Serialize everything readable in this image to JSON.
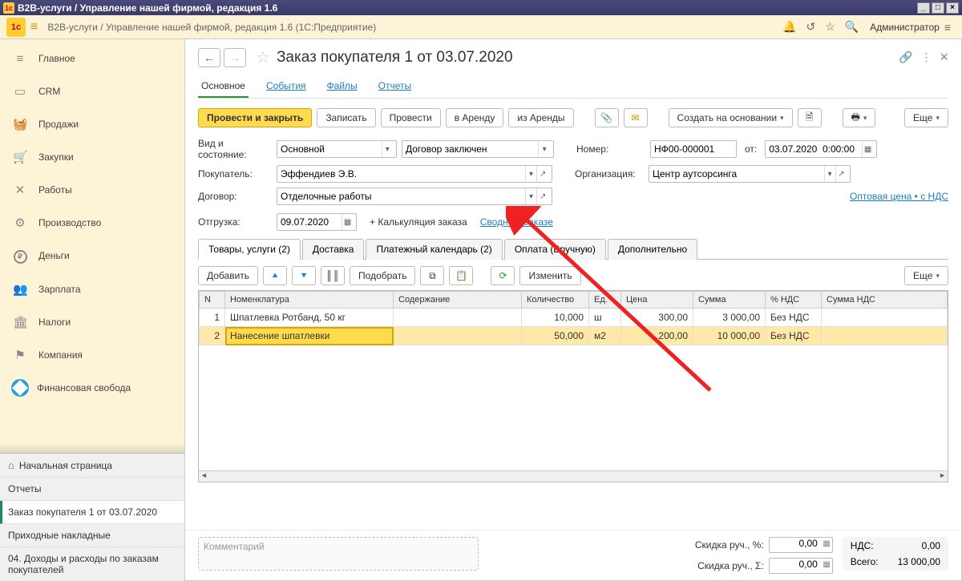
{
  "window": {
    "title": "B2B-услуги / Управление нашей фирмой, редакция 1.6"
  },
  "topbar": {
    "breadcrumb": "B2B-услуги / Управление нашей фирмой, редакция 1.6  (1С:Предприятие)",
    "admin": "Администратор"
  },
  "sidebar": {
    "nav": [
      {
        "label": "Главное",
        "icon": "≡"
      },
      {
        "label": "CRM",
        "icon": "▣"
      },
      {
        "label": "Продажи",
        "icon": "🛍"
      },
      {
        "label": "Закупки",
        "icon": "🛒"
      },
      {
        "label": "Работы",
        "icon": "✖"
      },
      {
        "label": "Производство",
        "icon": "🏭"
      },
      {
        "label": "Деньги",
        "icon": "₽"
      },
      {
        "label": "Зарплата",
        "icon": "👥"
      },
      {
        "label": "Налоги",
        "icon": "🏛"
      },
      {
        "label": "Компания",
        "icon": "⚑"
      }
    ],
    "fin": "Финансовая свобода",
    "open": [
      {
        "label": "Начальная страница",
        "home": true
      },
      {
        "label": "Отчеты"
      },
      {
        "label": "Заказ покупателя 1 от 03.07.2020",
        "active": true
      },
      {
        "label": "Приходные накладные"
      },
      {
        "label": "04. Доходы и расходы по заказам покупателей"
      }
    ]
  },
  "doc": {
    "title": "Заказ покупателя 1 от 03.07.2020",
    "subtabs": [
      "Основное",
      "События",
      "Файлы",
      "Отчеты"
    ],
    "toolbar": {
      "post_close": "Провести и закрыть",
      "write": "Записать",
      "post": "Провести",
      "to_rent": "в Аренду",
      "from_rent": "из Аренды",
      "create_based": "Создать на основании",
      "more": "Еще"
    },
    "form": {
      "kind_label": "Вид и состояние:",
      "kind": "Основной",
      "status": "Договор заключен",
      "num_label": "Номер:",
      "number": "НФ00-000001",
      "ot": "от:",
      "date": "03.07.2020  0:00:00",
      "buyer_label": "Покупатель:",
      "buyer": "Эффендиев Э.В.",
      "org_label": "Организация:",
      "org": "Центр аутсорсинга",
      "contract_label": "Договор:",
      "contract": "Отделочные работы",
      "price_type_link": "Оптовая цена • с НДС",
      "ship_label": "Отгрузка:",
      "ship_date": "09.07.2020",
      "calc": "+ Калькуляция заказа",
      "summary_link": "Сводно о заказе"
    },
    "inner_tabs": [
      "Товары, услуги (2)",
      "Доставка",
      "Платежный календарь (2)",
      "Оплата (Вручную)",
      "Дополнительно"
    ],
    "table_toolbar": {
      "add": "Добавить",
      "pick": "Подобрать",
      "change": "Изменить",
      "more": "Еще"
    },
    "columns": [
      "N",
      "Номенклатура",
      "Содержание",
      "Количество",
      "Ед.",
      "Цена",
      "Сумма",
      "% НДС",
      "Сумма НДС"
    ],
    "rows": [
      {
        "n": "1",
        "nom": "Шпатлевка Ротбанд, 50 кг",
        "cont": "",
        "qty": "10,000",
        "unit": "ш",
        "price": "300,00",
        "sum": "3 000,00",
        "vat": "Без НДС",
        "vatsum": ""
      },
      {
        "n": "2",
        "nom": "Нанесение шпатлевки",
        "cont": "",
        "qty": "50,000",
        "unit": "м2",
        "price": "200,00",
        "sum": "10 000,00",
        "vat": "Без НДС",
        "vatsum": ""
      }
    ],
    "footer": {
      "comment_placeholder": "Комментарий",
      "disc_pct_label": "Скидка руч., %:",
      "disc_pct": "0,00",
      "disc_sum_label": "Скидка руч., Σ:",
      "disc_sum": "0,00",
      "vat_label": "НДС:",
      "vat": "0,00",
      "total_label": "Всего:",
      "total": "13 000,00"
    }
  }
}
